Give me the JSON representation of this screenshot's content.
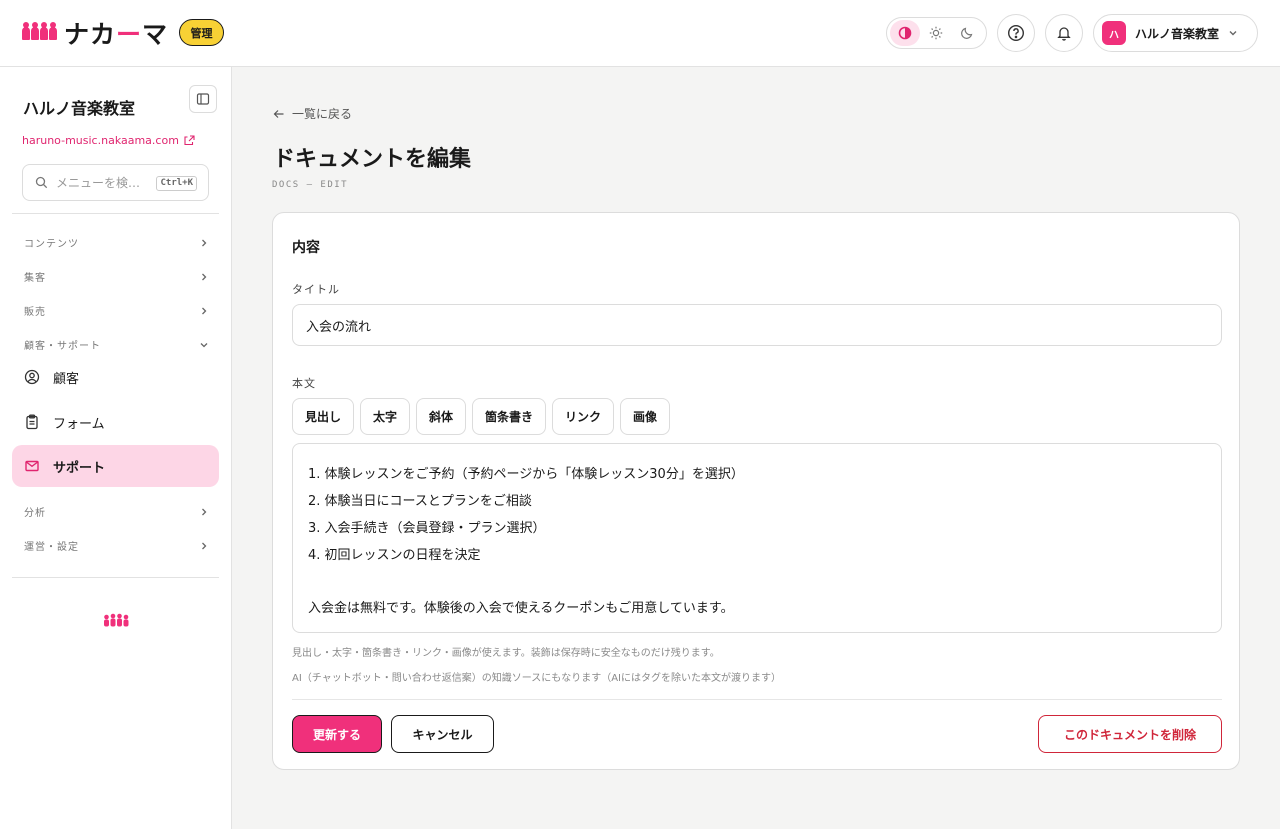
{
  "header": {
    "logo_text_a": "ナカ",
    "logo_text_dash": "ー",
    "logo_text_b": "マ",
    "admin_badge": "管理",
    "account_avatar": "ハ",
    "account_name": "ハルノ音楽教室"
  },
  "sidebar": {
    "org_name": "ハルノ音楽教室",
    "org_url": "haruno-music.nakaama.com",
    "search_placeholder": "メニューを検…",
    "search_shortcut": "Ctrl+K",
    "groups": {
      "content": "コンテンツ",
      "marketing": "集客",
      "sales": "販売",
      "customer_support": "顧客・サポート",
      "analytics": "分析",
      "operations": "運営・設定"
    },
    "items": {
      "customers": "顧客",
      "forms": "フォーム",
      "support": "サポート"
    }
  },
  "main": {
    "back_label": "一覧に戻る",
    "page_title": "ドキュメントを編集",
    "page_subtitle": "DOCS — EDIT",
    "card_title": "内容",
    "title_label": "タイトル",
    "title_value": "入会の流れ",
    "body_label": "本文",
    "toolbar": [
      "見出し",
      "太字",
      "斜体",
      "箇条書き",
      "リンク",
      "画像"
    ],
    "body_lines": [
      "1. 体験レッスンをご予約（予約ページから「体験レッスン30分」を選択）",
      "2. 体験当日にコースとプランをご相談",
      "3. 入会手続き（会員登録・プラン選択）",
      "4. 初回レッスンの日程を決定",
      "",
      "入会金は無料です。体験後の入会で使えるクーポンもご用意しています。"
    ],
    "hint_1": "見出し・太字・箇条書き・リンク・画像が使えます。装飾は保存時に安全なものだけ残ります。",
    "hint_2": "AI（チャットボット・問い合わせ返信案）の知識ソースにもなります（AIにはタグを除いた本文が渡ります）",
    "update_button": "更新する",
    "cancel_button": "キャンセル",
    "delete_button": "このドキュメントを削除"
  },
  "colors": {
    "accent": "#f0307b",
    "badge": "#f8d135",
    "danger": "#d0263a",
    "active_nav": "#fdd6e6"
  }
}
